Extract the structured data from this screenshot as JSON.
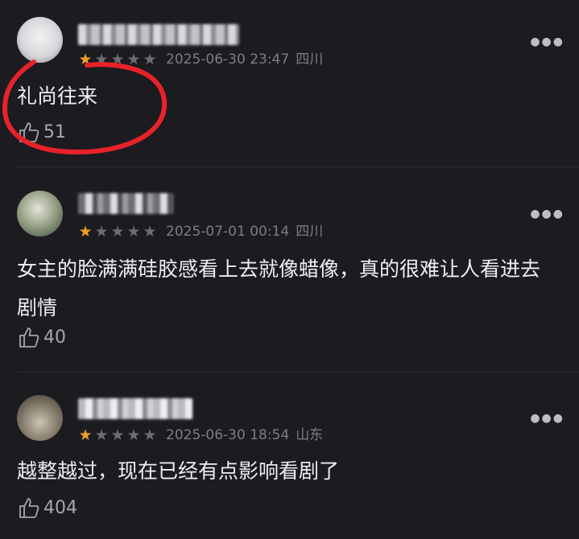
{
  "comments": [
    {
      "rating": 1,
      "date": "2025-06-30 23:47",
      "location": "四川",
      "text": "礼尚往来",
      "likes": "51"
    },
    {
      "rating": 1,
      "date": "2025-07-01 00:14",
      "location": "四川",
      "text": "女主的脸满满硅胶感看上去就像蜡像，真的很难让人看进去剧情",
      "likes": "40"
    },
    {
      "rating": 1,
      "date": "2025-06-30 18:54",
      "location": "山东",
      "text": "越整越过，现在已经有点影响看剧了",
      "likes": "404"
    }
  ],
  "more_icon": "more-dots-icon",
  "like_icon": "thumbs-up-icon",
  "colors": {
    "star_on": "#f0a020",
    "highlight": "#e8222a",
    "background": "#1c1b20"
  }
}
